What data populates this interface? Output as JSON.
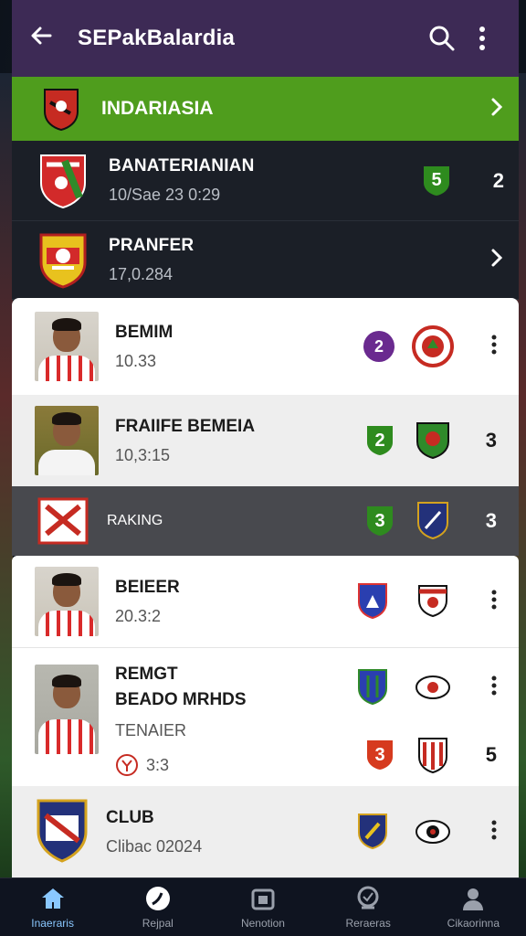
{
  "header": {
    "title": "SEPakBalardia",
    "back_icon": "arrow-left-icon",
    "search_icon": "search-icon",
    "menu_icon": "more-vert-icon"
  },
  "league": {
    "label": "INDARIASIA"
  },
  "dark_rows": [
    {
      "title": "BANATERIANIAN",
      "subtitle": "10/Sae 23 0:29",
      "badge": "5",
      "value": "2"
    },
    {
      "title": "PRANFER",
      "subtitle": "17,0.284"
    }
  ],
  "players": [
    {
      "name": "BEMIM",
      "sub": "10.33",
      "badge": "2"
    },
    {
      "name": "FRAIIFE BEMEIA",
      "sub": "10,3:15",
      "badge": "2",
      "value": "3"
    },
    {
      "name": "BEIEER",
      "sub": "20.3:2"
    },
    {
      "name": "REMGT",
      "name2": "BEADO MRHDS",
      "sub": "TENAIER",
      "sub2": "3:3",
      "badge": "3",
      "value": "5"
    },
    {
      "name": "CLUB",
      "sub": "Clibac 02024"
    }
  ],
  "ranking": {
    "label": "RAKING",
    "badge": "3",
    "value": "3"
  },
  "nav": [
    {
      "label": "Inaeraris",
      "icon": "home-icon"
    },
    {
      "label": "Rejpal",
      "icon": "ball-icon"
    },
    {
      "label": "Nenotion",
      "icon": "calendar-icon"
    },
    {
      "label": "Reraeras",
      "icon": "trophy-icon"
    },
    {
      "label": "Cikaorinna",
      "icon": "person-icon"
    }
  ],
  "colors": {
    "header_bg": "#3d2a55",
    "league_bg": "#4f9d1d",
    "badge_green": "#2e8b1e",
    "badge_purple": "#6a2a8f",
    "badge_red": "#d63a1e",
    "nav_active": "#8ac8ff"
  }
}
